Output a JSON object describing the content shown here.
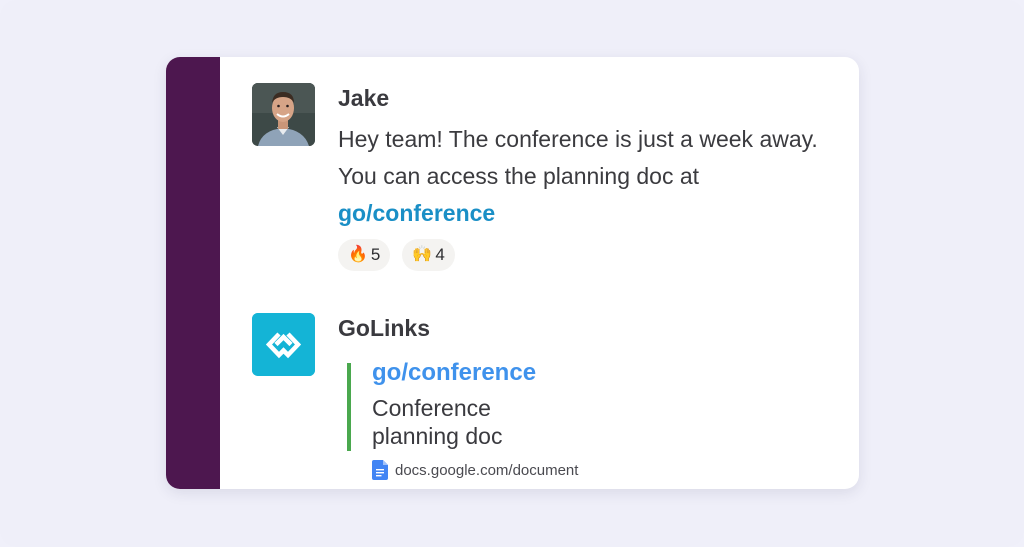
{
  "colors": {
    "sidebar": "#4d174f",
    "link": "#1a8fc6",
    "unfurl_title": "#3f92ec",
    "unfurl_bar": "#4aa84e",
    "golinks_logo": "#17b6d8"
  },
  "messages": {
    "jake": {
      "author": "Jake",
      "text": "Hey team! The conference is just a week away. You can access the planning doc at ",
      "link": "go/conference",
      "reactions": [
        {
          "emoji": "🔥",
          "icon": "fire-icon",
          "count": "5"
        },
        {
          "emoji": "🙌",
          "icon": "raised-hands-icon",
          "count": "4"
        }
      ]
    },
    "golinks": {
      "author": "GoLinks",
      "unfurl": {
        "title": "go/conference",
        "description": "Conference planning doc",
        "source_icon": "google-docs-icon",
        "source": "docs.google.com/document"
      }
    }
  }
}
